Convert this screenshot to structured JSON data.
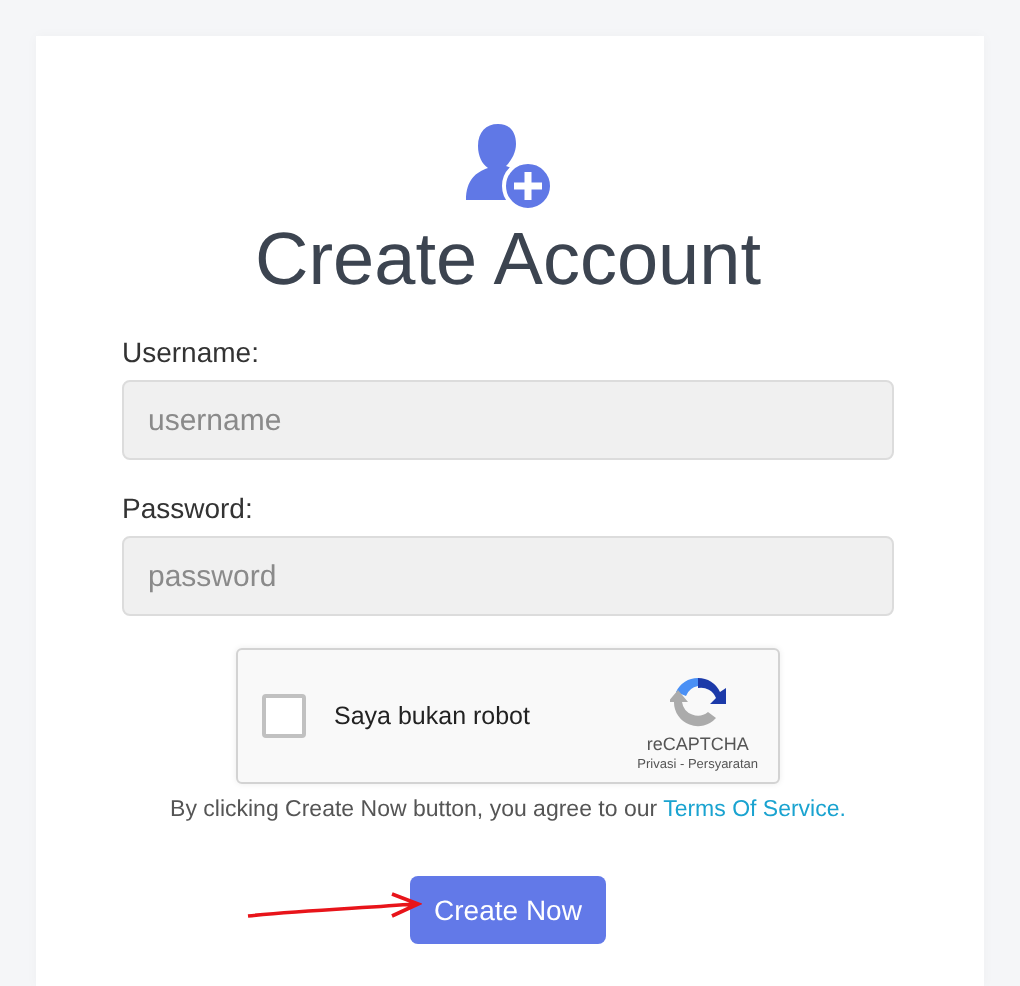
{
  "title": "Create Account",
  "fields": [
    {
      "label": "Username:",
      "placeholder": "username"
    },
    {
      "label": "Password:",
      "placeholder": "password"
    }
  ],
  "captcha": {
    "label": "Saya bukan robot",
    "checked": false,
    "brand": "reCAPTCHA",
    "links": "Privasi - Persyaratan"
  },
  "terms": {
    "text": "By clicking Create Now button, you agree to our ",
    "link": "Terms Of Service."
  },
  "button": "Create Now"
}
